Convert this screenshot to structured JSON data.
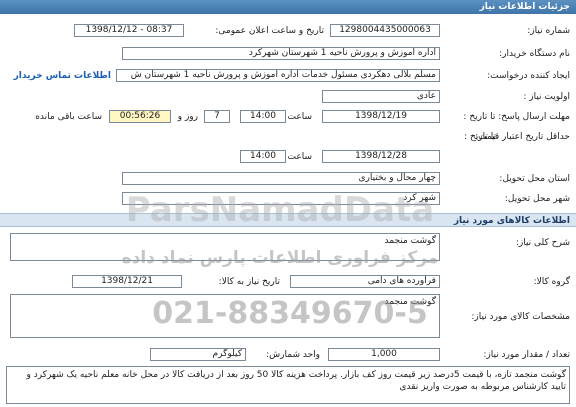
{
  "header": {
    "title": "جزئیات اطلاعات نیاز"
  },
  "fields": {
    "need_number": {
      "label": "شماره نیاز:",
      "value": "1298004435000063"
    },
    "announce_datetime": {
      "label": "تاریخ و ساعت اعلان عمومی:",
      "value": "1398/12/12 - 08:37"
    },
    "buyer": {
      "label": "نام دستگاه خریدار:",
      "value": "اداره آموزش و پرورش ناحیه 1 شهرستان شهرکرد"
    },
    "creator": {
      "label": "ایجاد کننده درخواست:",
      "value": "مسلم بلالی دهکردی مسئول خدمات اداره آموزش و پرورش ناحیه 1 شهرستان ش",
      "contact_link": "اطلاعات تماس خریدار"
    },
    "priority": {
      "label": "اولویت نیاز :",
      "value": "عادی"
    },
    "reply_deadline": {
      "label": "مهلت ارسال پاسخ: تا تاریخ :",
      "date": "1398/12/19",
      "time_label": "ساعت",
      "time": "14:00",
      "days": "7",
      "days_label": "روز و",
      "remaining": "00:56:26",
      "remaining_label": "ساعت باقی مانده"
    },
    "price_validity": {
      "label": "حداقل تاریخ اعتبار قیمت:",
      "to_date_label": "تا تاریخ :",
      "date": "1398/12/28",
      "time_label": "ساعت",
      "time": "14:00"
    },
    "province": {
      "label": "استان محل تحویل:",
      "value": "چهار محال و بختیاری"
    },
    "city": {
      "label": "شهر محل تحویل:",
      "value": "شهر کرد"
    }
  },
  "goods_section": {
    "title": "اطلاعات کالاهای مورد نیاز"
  },
  "goods": {
    "general_desc": {
      "label": "شرح کلی نیاز:",
      "value": "گوشت منجمد"
    },
    "group": {
      "label": "گروه کالا:",
      "value": "فراورده های دامی",
      "need_date_label": "تاریخ نیاز به کالا:",
      "need_date": "1398/12/21"
    },
    "spec": {
      "label": "مشخصات کالای مورد نیاز:",
      "value": "گوشت منجمد"
    },
    "qty": {
      "label": "تعداد / مقدار مورد نیاز:",
      "value": "1,000",
      "unit_label": "واحد شمارش:",
      "unit": "کیلوگرم"
    },
    "notes": {
      "value": "گوشت منجمد تازه، با قیمت 5درصد زیر قیمت روز کف بازار. پرداخت هزینه کالا 50 روز بعد از دریافت کالا در محل خانه معلم ناحیه یک شهرکرد و تایید کارشناس مربوطه به صورت واریز نقدی"
    }
  },
  "watermark": {
    "brand": "ParsNamadData",
    "line1": "مرکز فراوری اطلاعات پارس نماد داده",
    "phone": "021-88349670-5"
  }
}
